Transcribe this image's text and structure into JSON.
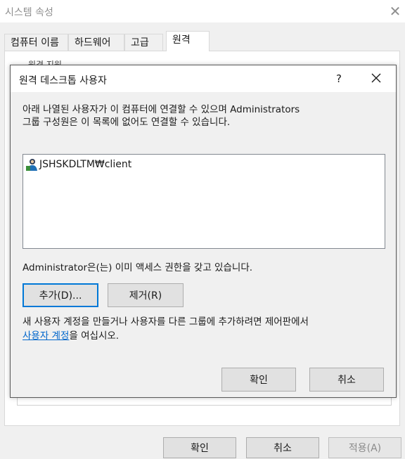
{
  "outer": {
    "title": "시스템 속성",
    "tabs": [
      {
        "label": "컴퓨터 이름"
      },
      {
        "label": "하드웨어"
      },
      {
        "label": "고급"
      },
      {
        "label": "원격"
      }
    ],
    "peek_text": "원격 지원",
    "buttons": {
      "ok": "확인",
      "cancel": "취소",
      "apply": "적용(A)"
    }
  },
  "dialog": {
    "title": "원격 데스크톱 사용자",
    "help": "?",
    "description_line1": "아래 나열된 사용자가 이 컴퓨터에 연결할 수 있으며 Administrators",
    "description_line2": "그룹 구성원은 이 목록에 없어도 연결할 수 있습니다.",
    "users": [
      {
        "name": "JSHSKDLTM₩client"
      }
    ],
    "admin_note": "Administrator은(는) 이미 액세스 권한을 갖고 있습니다.",
    "add_button": "추가(D)...",
    "remove_button": "제거(R)",
    "info_line1": "새 사용자 계정을 만들거나 사용자를 다른 그룹에 추가하려면 제어판에서",
    "info_link": "사용자 계정",
    "info_line2_suffix": "을 여십시오.",
    "ok_button": "확인",
    "cancel_button": "취소"
  }
}
